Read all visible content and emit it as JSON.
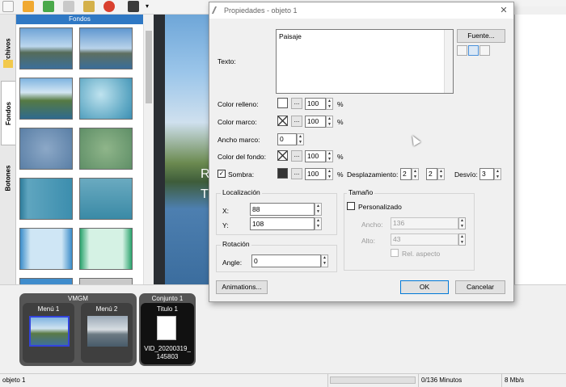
{
  "panel": {
    "header": "Fondos",
    "tabs": [
      "Archivos",
      "Fondos",
      "Botones"
    ]
  },
  "preview": {
    "text1": "R",
    "text2": "T"
  },
  "menus": {
    "group1_label": "VMGM",
    "group2_label": "Conjunto 1",
    "item1": "Menú 1",
    "item2": "Menú 2",
    "item3": "Titulo 1",
    "item3_file": "VID_20200319_",
    "item3_file2": "145803"
  },
  "status": {
    "object": "objeto 1",
    "minutes": "0/136 Minutos",
    "rate": "8 Mb/s"
  },
  "dialog": {
    "title": "Propiedades - objeto 1",
    "close": "✕",
    "texto_label": "Texto:",
    "texto_value": "Paisaje",
    "font_button": "Fuente...",
    "color_relleno_label": "Color relleno:",
    "color_relleno_value": "100",
    "color_marco_label": "Color marco:",
    "color_marco_value": "100",
    "ancho_marco_label": "Ancho marco:",
    "ancho_marco_value": "0",
    "color_fondo_label": "Color del fondo:",
    "color_fondo_value": "100",
    "sombra_label": "Sombra:",
    "sombra_value": "100",
    "desplazamiento_label": "Desplazamiento:",
    "desplazamiento_x": "2",
    "desplazamiento_y": "2",
    "desvio_label": "Desvío:",
    "desvio_value": "3",
    "pct": "%",
    "dots": "...",
    "localizacion_title": "Localización",
    "x_label": "X:",
    "x_value": "88",
    "y_label": "Y:",
    "y_value": "108",
    "rotacion_title": "Rotación",
    "angle_label": "Angle:",
    "angle_value": "0",
    "tamano_title": "Tamaño",
    "personalizado_label": "Personalizado",
    "ancho_label": "Ancho:",
    "ancho_value": "136",
    "alto_label": "Alto:",
    "alto_value": "43",
    "rel_aspecto_label": "Rel. aspecto",
    "animations_button": "Animations...",
    "ok_button": "OK",
    "cancel_button": "Cancelar"
  },
  "colors": {
    "accent": "#2f78c4",
    "dialog_bg": "#f0f0f0",
    "menu_group_bg": "#555555"
  }
}
